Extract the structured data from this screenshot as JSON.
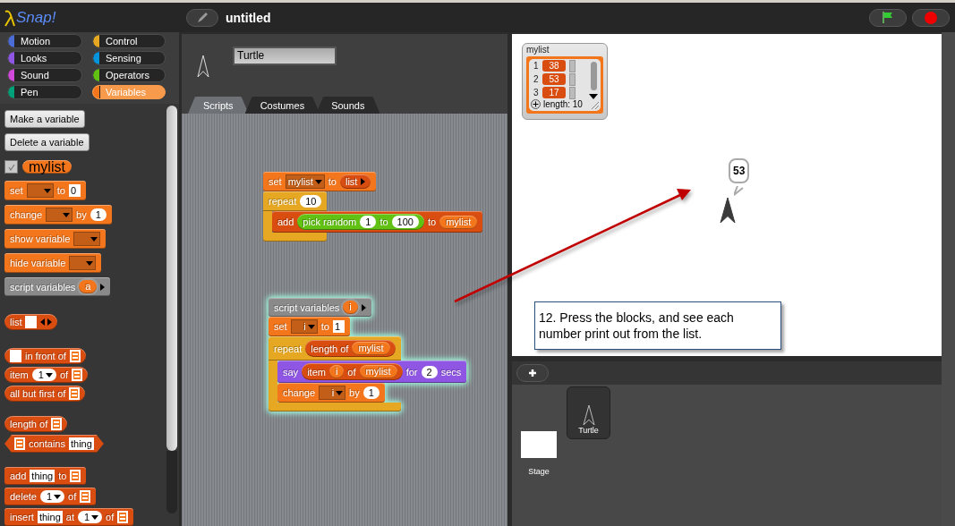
{
  "logo": "Snap!",
  "project_title": "untitled",
  "categories": [
    {
      "label": "Motion",
      "color": "#4a6cd4",
      "selected": false
    },
    {
      "label": "Control",
      "color": "#e6a822",
      "selected": false
    },
    {
      "label": "Looks",
      "color": "#8f56e3",
      "selected": false
    },
    {
      "label": "Sensing",
      "color": "#0494dc",
      "selected": false
    },
    {
      "label": "Sound",
      "color": "#cf4ad9",
      "selected": false
    },
    {
      "label": "Operators",
      "color": "#62c213",
      "selected": false
    },
    {
      "label": "Pen",
      "color": "#00a178",
      "selected": false
    },
    {
      "label": "Variables",
      "color": "#f3761d",
      "selected": true
    }
  ],
  "palette": {
    "buttons": [
      "Make a variable",
      "Delete a variable"
    ],
    "variable": {
      "name": "mylist",
      "checked": true
    },
    "block_groups": [
      [
        {
          "kind": "command",
          "color": "#f3761d",
          "parts": [
            {
              "kind": "label",
              "text": "set"
            },
            {
              "kind": "dropdown"
            },
            {
              "kind": "label",
              "text": "to"
            },
            {
              "kind": "text",
              "text": "0"
            }
          ]
        },
        {
          "kind": "command",
          "color": "#f3761d",
          "parts": [
            {
              "kind": "label",
              "text": "change"
            },
            {
              "kind": "dropdown"
            },
            {
              "kind": "label",
              "text": "by"
            },
            {
              "kind": "num",
              "text": "1"
            }
          ]
        },
        {
          "kind": "command",
          "color": "#f3761d",
          "parts": [
            {
              "kind": "label",
              "text": "show variable"
            },
            {
              "kind": "dropdown"
            }
          ]
        },
        {
          "kind": "command",
          "color": "#f3761d",
          "parts": [
            {
              "kind": "label",
              "text": "hide variable"
            },
            {
              "kind": "dropdown"
            }
          ]
        },
        {
          "kind": "command",
          "color": "#8a8a8a",
          "parts": [
            {
              "kind": "label",
              "text": "script variables"
            },
            {
              "kind": "var",
              "text": "a",
              "ring": true
            },
            {
              "kind": "arrow"
            }
          ]
        }
      ],
      [
        {
          "kind": "reporter",
          "color": "#d94d11",
          "parts": [
            {
              "kind": "label",
              "text": "list"
            },
            {
              "kind": "text"
            },
            {
              "kind": "arrows"
            }
          ]
        }
      ],
      [
        {
          "kind": "reporter",
          "color": "#d94d11",
          "parts": [
            {
              "kind": "text"
            },
            {
              "kind": "label",
              "text": "in front of"
            },
            {
              "kind": "listslot"
            }
          ]
        },
        {
          "kind": "reporter",
          "color": "#d94d11",
          "parts": [
            {
              "kind": "label",
              "text": "item"
            },
            {
              "kind": "numdrop",
              "text": "1"
            },
            {
              "kind": "label",
              "text": "of"
            },
            {
              "kind": "listslot"
            }
          ]
        },
        {
          "kind": "reporter",
          "color": "#d94d11",
          "parts": [
            {
              "kind": "label",
              "text": "all but first of"
            },
            {
              "kind": "listslot"
            }
          ]
        }
      ],
      [
        {
          "kind": "reporter",
          "color": "#d94d11",
          "parts": [
            {
              "kind": "label",
              "text": "length of"
            },
            {
              "kind": "listslot"
            }
          ]
        },
        {
          "kind": "predicate",
          "color": "#d94d11",
          "parts": [
            {
              "kind": "listslot"
            },
            {
              "kind": "label",
              "text": "contains"
            },
            {
              "kind": "text",
              "text": "thing"
            }
          ]
        }
      ],
      [
        {
          "kind": "command",
          "color": "#d94d11",
          "parts": [
            {
              "kind": "label",
              "text": "add"
            },
            {
              "kind": "text",
              "text": "thing"
            },
            {
              "kind": "label",
              "text": "to"
            },
            {
              "kind": "listslot"
            }
          ]
        },
        {
          "kind": "command",
          "color": "#d94d11",
          "parts": [
            {
              "kind": "label",
              "text": "delete"
            },
            {
              "kind": "numdrop",
              "text": "1"
            },
            {
              "kind": "label",
              "text": "of"
            },
            {
              "kind": "listslot"
            }
          ]
        },
        {
          "kind": "command",
          "color": "#d94d11",
          "parts": [
            {
              "kind": "label",
              "text": "insert"
            },
            {
              "kind": "text",
              "text": "thing"
            },
            {
              "kind": "label",
              "text": "at"
            },
            {
              "kind": "numdrop",
              "text": "1"
            },
            {
              "kind": "label",
              "text": "of"
            },
            {
              "kind": "listslot"
            }
          ]
        }
      ]
    ]
  },
  "sprite_name": "Turtle",
  "tabs": [
    {
      "label": "Scripts",
      "selected": true
    },
    {
      "label": "Costumes",
      "selected": false
    },
    {
      "label": "Sounds",
      "selected": false
    }
  ],
  "scripts": [
    {
      "highlighted": false,
      "blocks": [
        {
          "kind": "command",
          "color": "#f3761d",
          "parts": [
            {
              "kind": "label",
              "text": "set"
            },
            {
              "kind": "dropdown",
              "text": "mylist"
            },
            {
              "kind": "label",
              "text": "to"
            },
            {
              "kind": "reporter",
              "color": "#d94d11",
              "parts": [
                {
                  "kind": "label",
                  "text": "list"
                },
                {
                  "kind": "arrow"
                }
              ]
            }
          ]
        },
        {
          "kind": "c",
          "color": "#e6a822",
          "parts": [
            {
              "kind": "label",
              "text": "repeat"
            },
            {
              "kind": "num",
              "text": "10"
            }
          ],
          "body": [
            {
              "kind": "command",
              "color": "#d94d11",
              "parts": [
                {
                  "kind": "label",
                  "text": "add"
                },
                {
                  "kind": "reporter",
                  "color": "#62c213",
                  "parts": [
                    {
                      "kind": "label",
                      "text": "pick random"
                    },
                    {
                      "kind": "num",
                      "text": "1"
                    },
                    {
                      "kind": "label",
                      "text": "to"
                    },
                    {
                      "kind": "num",
                      "text": "100"
                    }
                  ]
                },
                {
                  "kind": "label",
                  "text": "to"
                },
                {
                  "kind": "var",
                  "text": "mylist"
                }
              ]
            }
          ]
        }
      ]
    },
    {
      "highlighted": true,
      "blocks": [
        {
          "kind": "command",
          "color": "#8a8a8a",
          "parts": [
            {
              "kind": "label",
              "text": "script variables"
            },
            {
              "kind": "var",
              "text": "i",
              "ring": true
            },
            {
              "kind": "arrow"
            }
          ]
        },
        {
          "kind": "command",
          "color": "#f3761d",
          "parts": [
            {
              "kind": "label",
              "text": "set"
            },
            {
              "kind": "dropdown",
              "text": "i"
            },
            {
              "kind": "label",
              "text": "to"
            },
            {
              "kind": "text",
              "text": "1"
            }
          ]
        },
        {
          "kind": "c",
          "color": "#e6a822",
          "parts": [
            {
              "kind": "label",
              "text": "repeat"
            },
            {
              "kind": "reporter",
              "color": "#d94d11",
              "parts": [
                {
                  "kind": "label",
                  "text": "length of"
                },
                {
                  "kind": "var",
                  "text": "mylist"
                }
              ]
            }
          ],
          "body": [
            {
              "kind": "command",
              "color": "#8f56e3",
              "parts": [
                {
                  "kind": "label",
                  "text": "say"
                },
                {
                  "kind": "reporter",
                  "color": "#d94d11",
                  "parts": [
                    {
                      "kind": "label",
                      "text": "item"
                    },
                    {
                      "kind": "var",
                      "text": "i"
                    },
                    {
                      "kind": "label",
                      "text": "of"
                    },
                    {
                      "kind": "var",
                      "text": "mylist"
                    }
                  ]
                },
                {
                  "kind": "label",
                  "text": "for"
                },
                {
                  "kind": "num",
                  "text": "2"
                },
                {
                  "kind": "label",
                  "text": "secs"
                }
              ]
            },
            {
              "kind": "command",
              "color": "#f3761d",
              "parts": [
                {
                  "kind": "label",
                  "text": "change"
                },
                {
                  "kind": "dropdown",
                  "text": "i"
                },
                {
                  "kind": "label",
                  "text": "by"
                },
                {
                  "kind": "num",
                  "text": "1"
                }
              ]
            }
          ]
        }
      ]
    }
  ],
  "stage": {
    "watcher": {
      "name": "mylist",
      "items": [
        {
          "index": "1",
          "value": "38"
        },
        {
          "index": "2",
          "value": "53"
        },
        {
          "index": "3",
          "value": "17"
        }
      ],
      "length_label": "length: 10"
    },
    "speech": "53",
    "annotation": "12.  Press the blocks, and see each number print out from the list."
  },
  "corral": {
    "stage_label": "Stage",
    "sprites": [
      {
        "name": "Turtle",
        "selected": true
      }
    ]
  }
}
